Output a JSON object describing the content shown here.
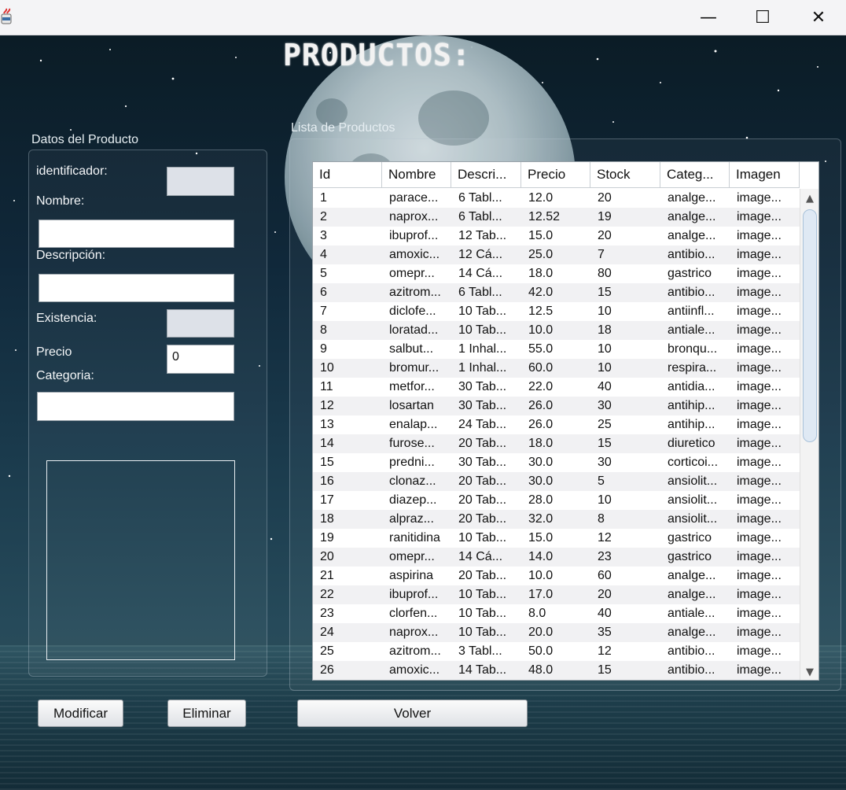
{
  "window": {
    "icon": "java-cup-icon",
    "controls": {
      "minimize": "—",
      "maximize": "☐",
      "close": "✕"
    }
  },
  "page_title": "PRODUCTOS:",
  "left_panel": {
    "title": "Datos del Producto",
    "labels": {
      "identificador": "identificador:",
      "nombre": "Nombre:",
      "descripcion": "Descripción:",
      "existencia": "Existencia:",
      "precio": "Precio",
      "categoria": "Categoria:"
    },
    "values": {
      "identificador": "",
      "nombre": "",
      "descripcion": "",
      "existencia": "",
      "precio": "0",
      "categoria": ""
    }
  },
  "list_panel": {
    "title": "Lista de Productos",
    "columns": [
      "Id",
      "Nombre",
      "Descri...",
      "Precio",
      "Stock",
      "Categ...",
      "Imagen"
    ],
    "rows": [
      [
        "1",
        "parace...",
        "6 Tabl...",
        "12.0",
        "20",
        "analge...",
        "image..."
      ],
      [
        "2",
        "naprox...",
        "6 Tabl...",
        "12.52",
        "19",
        "analge...",
        "image..."
      ],
      [
        "3",
        "ibuprof...",
        "12 Tab...",
        "15.0",
        "20",
        "analge...",
        "image..."
      ],
      [
        "4",
        "amoxic...",
        "12 Cá...",
        "25.0",
        "7",
        "antibio...",
        "image..."
      ],
      [
        "5",
        "omepr...",
        "14 Cá...",
        "18.0",
        "80",
        "gastrico",
        "image..."
      ],
      [
        "6",
        "azitrom...",
        "6 Tabl...",
        "42.0",
        "15",
        "antibio...",
        "image..."
      ],
      [
        "7",
        "diclofe...",
        "10 Tab...",
        "12.5",
        "10",
        "antiinfl...",
        "image..."
      ],
      [
        "8",
        "loratad...",
        "10 Tab...",
        "10.0",
        "18",
        "antiale...",
        "image..."
      ],
      [
        "9",
        "salbut...",
        "1 Inhal...",
        "55.0",
        "10",
        "bronqu...",
        "image..."
      ],
      [
        "10",
        "bromur...",
        "1 Inhal...",
        "60.0",
        "10",
        "respira...",
        "image..."
      ],
      [
        "11",
        "metfor...",
        "30 Tab...",
        "22.0",
        "40",
        "antidia...",
        "image..."
      ],
      [
        "12",
        "losartan",
        "30 Tab...",
        "26.0",
        "30",
        "antihip...",
        "image..."
      ],
      [
        "13",
        "enalap...",
        "24 Tab...",
        "26.0",
        "25",
        "antihip...",
        "image..."
      ],
      [
        "14",
        "furose...",
        "20 Tab...",
        "18.0",
        "15",
        "diuretico",
        "image..."
      ],
      [
        "15",
        "predni...",
        "30 Tab...",
        "30.0",
        "30",
        "corticoi...",
        "image..."
      ],
      [
        "16",
        "clonaz...",
        "20 Tab...",
        "30.0",
        "5",
        "ansiolit...",
        "image..."
      ],
      [
        "17",
        "diazep...",
        "20 Tab...",
        "28.0",
        "10",
        "ansiolit...",
        "image..."
      ],
      [
        "18",
        "alpraz...",
        "20 Tab...",
        "32.0",
        "8",
        "ansiolit...",
        "image..."
      ],
      [
        "19",
        "ranitidina",
        "10 Tab...",
        "15.0",
        "12",
        "gastrico",
        "image..."
      ],
      [
        "20",
        "omepr...",
        "14 Cá...",
        "14.0",
        "23",
        "gastrico",
        "image..."
      ],
      [
        "21",
        "aspirina",
        "20 Tab...",
        "10.0",
        "60",
        "analge...",
        "image..."
      ],
      [
        "22",
        "ibuprof...",
        "10 Tab...",
        "17.0",
        "20",
        "analge...",
        "image..."
      ],
      [
        "23",
        "clorfen...",
        "10 Tab...",
        "8.0",
        "40",
        "antiale...",
        "image..."
      ],
      [
        "24",
        "naprox...",
        "10 Tab...",
        "20.0",
        "35",
        "analge...",
        "image..."
      ],
      [
        "25",
        "azitrom...",
        "3 Tabl...",
        "50.0",
        "12",
        "antibio...",
        "image..."
      ],
      [
        "26",
        "amoxic...",
        "14 Tab...",
        "48.0",
        "15",
        "antibio...",
        "image..."
      ]
    ]
  },
  "buttons": {
    "modificar": "Modificar",
    "eliminar": "Eliminar",
    "volver": "Volver"
  }
}
